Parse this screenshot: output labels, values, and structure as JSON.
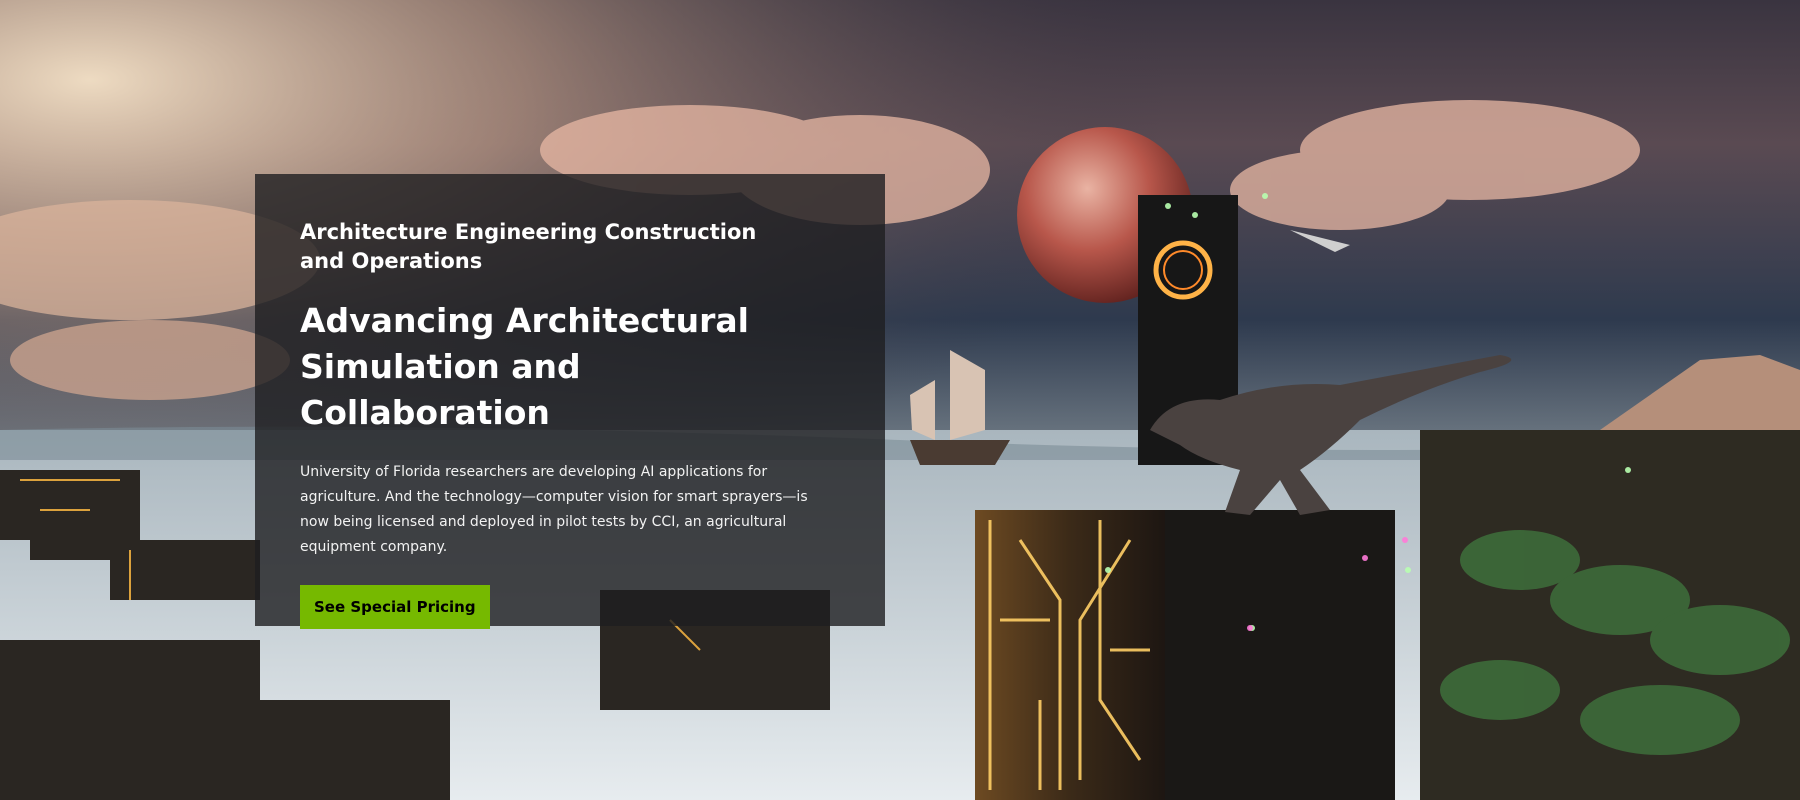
{
  "hero": {
    "eyebrow": "Architecture Engineering Construction and Operations",
    "headline": "Advancing Architectural Simulation and Collaboration",
    "body": "University of Florida researchers are developing AI applications for agriculture. And the technology—computer vision for smart sprayers—is now being licensed and deployed in pilot tests by CCI, an agricultural equipment company.",
    "cta_label": "See Special Pricing"
  },
  "colors": {
    "accent": "#76b900",
    "panel_bg": "#1e1e20",
    "text": "#ffffff"
  }
}
